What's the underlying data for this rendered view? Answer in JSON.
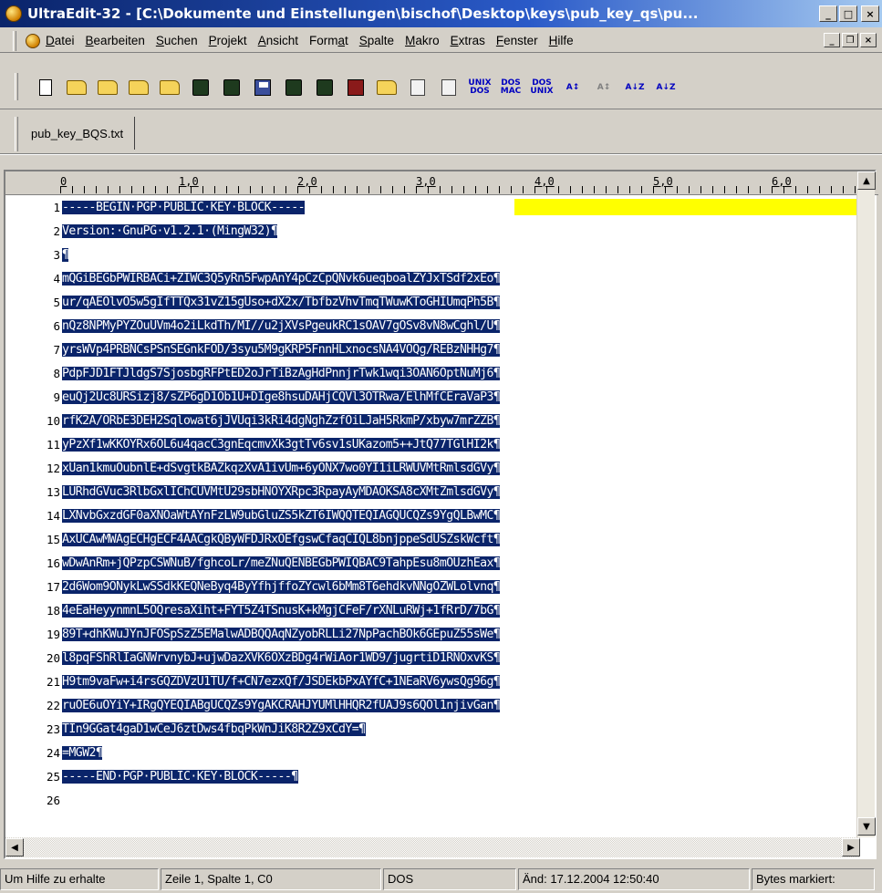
{
  "window": {
    "title": "UltraEdit-32 - [C:\\Dokumente und Einstellungen\\bischof\\Desktop\\keys\\pub_key_qs\\pu...",
    "minimize": "_",
    "maximize": "□",
    "close": "×"
  },
  "menu": {
    "items": [
      "Datei",
      "Bearbeiten",
      "Suchen",
      "Projekt",
      "Ansicht",
      "Format",
      "Spalte",
      "Makro",
      "Extras",
      "Fenster",
      "Hilfe"
    ],
    "mdi_min": "_",
    "mdi_restore": "❐",
    "mdi_close": "×"
  },
  "toolbar": {
    "unix_dos": "UNIX\nDOS",
    "dos_mac": "DOS\nMAC",
    "dos_unix": "DOS\nUNIX"
  },
  "tabs": [
    {
      "label": "pub_key_BQS.txt",
      "active": true
    }
  ],
  "ruler": {
    "labels": [
      "0",
      "1,0",
      "2,0",
      "3,0",
      "4,0",
      "5,0",
      "6,0"
    ]
  },
  "editor": {
    "lines": [
      {
        "num": "1",
        "text": "-----BEGIN·PGP·PUBLIC·KEY·BLOCK-----"
      },
      {
        "num": "2",
        "text": "Version:·GnuPG·v1.2.1·(MingW32)¶"
      },
      {
        "num": "3",
        "text": "¶"
      },
      {
        "num": "4",
        "text": "mQGiBEGbPWIRBACi+ZIWC3Q5yRn5FwpAnY4pCzCpQNvk6ueqboalZYJxTSdf2xEo¶"
      },
      {
        "num": "5",
        "text": "ur/qAEOlvO5w5gIfTTQx31vZ15gUso+dX2x/TbfbzVhvTmqTWuwKToGHIUmqPh5B¶"
      },
      {
        "num": "6",
        "text": "nQz8NPMyPYZOuUVm4o2iLkdTh/MI//u2jXVsPgeukRC1sOAV7gOSv8vN8wCghl/U¶"
      },
      {
        "num": "7",
        "text": "yrsWVp4PRBNCsPSnSEGnkFOD/3syu5M9gKRP5FnnHLxnocsNA4VOQg/REBzNHHg7¶"
      },
      {
        "num": "8",
        "text": "PdpFJD1FTJldgS7SjosbgRFPtED2oJrTiBzAgHdPnnjrTwk1wqi3OAN6OptNuMj6¶"
      },
      {
        "num": "9",
        "text": "euQj2Uc8URSizj8/sZP6gD1Ob1U+DIge8hsuDAHjCQVl3OTRwa/ElhMfCEraVaP3¶"
      },
      {
        "num": "10",
        "text": "rfK2A/ORbE3DEH2Sqlowat6jJVUqi3kRi4dgNghZzfOiLJaH5RkmP/xbyw7mrZZB¶"
      },
      {
        "num": "11",
        "text": "yPzXf1wKKOYRx6OL6u4qacC3gnEqcmvXk3gtTv6sv1sUKazom5++JtQ77TGlHI2k¶"
      },
      {
        "num": "12",
        "text": "xUan1kmuOubnlE+dSvgtkBAZkqzXvA1ivUm+6yONX7wo0YI1iLRWUVMtRmlsdGVy¶"
      },
      {
        "num": "13",
        "text": "LURhdGVuc3RlbGxlIChCUVMtU29sbHNOYXRpc3RpayAyMDAOKSA8cXMtZmlsdGVy¶"
      },
      {
        "num": "14",
        "text": "LXNvbGxzdGF0aXNOaWtAYnFzLW9ubGluZS5kZT6IWQQTEQIAGQUCQZs9YgQLBwMC¶"
      },
      {
        "num": "15",
        "text": "AxUCAwMWAgECHgECF4AACgkQByWFDJRxOEfgswCfaqCIQL8bnjppeSdUSZskWcft¶"
      },
      {
        "num": "16",
        "text": "wDwAnRm+jQPzpCSWNuB/fghcoLr/meZNuQENBEGbPWIQBAC9TahpEsu8mOUzhEax¶"
      },
      {
        "num": "17",
        "text": "2d6Wom9ONykLwSSdkKEQNeByq4ByYfhjffoZYcwl6bMm8T6ehdkvNNgOZWLolvnq¶"
      },
      {
        "num": "18",
        "text": "4eEaHeyynmnL5OQresaXiht+FYT5Z4TSnusK+kMgjCFeF/rXNLuRWj+1fRrD/7bG¶"
      },
      {
        "num": "19",
        "text": "89T+dhKWuJYnJFOSpSzZ5EMalwADBQQAqNZyobRLLi27NpPachBOk6GEpuZ55sWe¶"
      },
      {
        "num": "20",
        "text": "l8pqFShRlIaGNWrvnybJ+ujwDazXVK6OXzBDg4rWiAor1WD9/jugrtiD1RNOxvKS¶"
      },
      {
        "num": "21",
        "text": "H9tm9vaFw+i4rsGQZDVzU1TU/f+CN7ezxQf/JSDEkbPxAYfC+1NEaRV6ywsQg96g¶"
      },
      {
        "num": "22",
        "text": "ruOE6uOYiY+IRgQYEQIABgUCQZs9YgAKCRAHJYUMlHHQR2fUAJ9s6QOl1njivGan¶"
      },
      {
        "num": "23",
        "text": "TIn9GGat4gaD1wCeJ6ztDws4fbqPkWnJiK8R2Z9xCdY=¶"
      },
      {
        "num": "24",
        "text": "=MGW2¶"
      },
      {
        "num": "25",
        "text": "-----END·PGP·PUBLIC·KEY·BLOCK-----¶"
      },
      {
        "num": "26",
        "text": ""
      }
    ]
  },
  "status": {
    "help": "Um Hilfe zu erhalte",
    "position": "Zeile 1, Spalte 1, C0",
    "format": "DOS",
    "modified": "Änd: 17.12.2004 12:50:40",
    "selection": "Bytes markiert:"
  },
  "colors": {
    "selection_bg": "#0a246a",
    "selection_fg": "#ffffff",
    "current_line": "#ffff00",
    "title_bar": "#0a246a"
  }
}
